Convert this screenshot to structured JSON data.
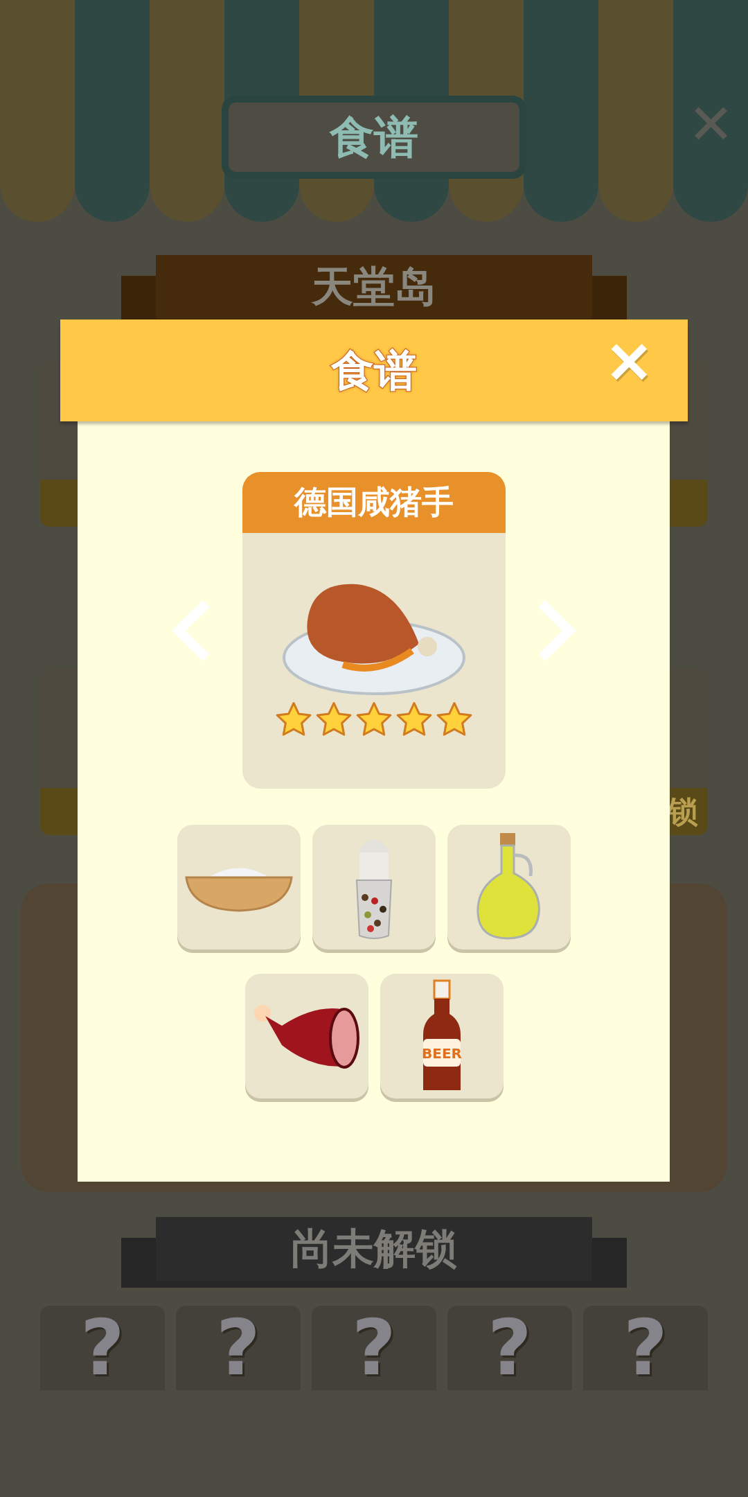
{
  "top_bar": {
    "title": "食谱",
    "close": "✕"
  },
  "region_banner": {
    "title": "天堂岛"
  },
  "background_card": {
    "label": "锁"
  },
  "locked_section": {
    "title": "尚未解锁",
    "slots": [
      {
        "label": "?"
      },
      {
        "label": "?"
      },
      {
        "label": "?"
      },
      {
        "label": "?"
      },
      {
        "label": "?"
      }
    ]
  },
  "modal": {
    "title": "食谱",
    "close": "✕",
    "dish": {
      "name": "德国咸猪手",
      "stars": 5
    },
    "ingredients": [
      {
        "kind": "salt"
      },
      {
        "kind": "pepper"
      },
      {
        "kind": "oil"
      },
      {
        "kind": "ham"
      },
      {
        "kind": "beer",
        "label": "BEER"
      }
    ]
  }
}
